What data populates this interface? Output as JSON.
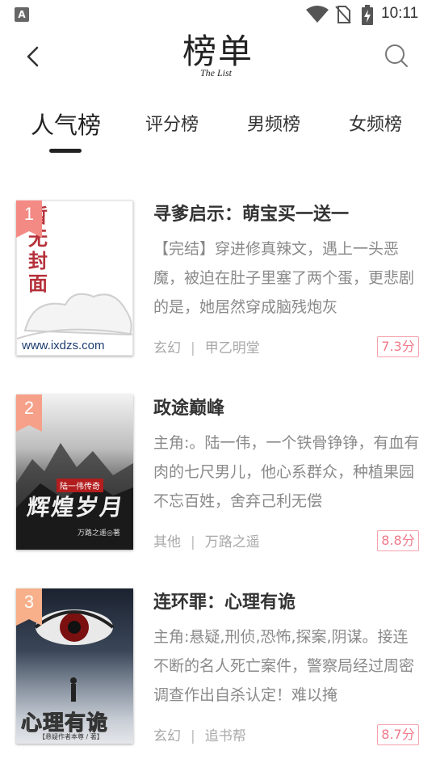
{
  "status_bar": {
    "app_icon_letter": "A",
    "time": "10:11",
    "icons": [
      "app-notification-icon",
      "wifi-icon",
      "no-sim-icon",
      "battery-charging-icon"
    ]
  },
  "header": {
    "title": "榜单",
    "subtitle": "The List",
    "back_icon": "chevron-left-icon",
    "search_icon": "search-icon"
  },
  "tabs": [
    {
      "label": "人气榜",
      "active": true
    },
    {
      "label": "评分榜",
      "active": false
    },
    {
      "label": "男频榜",
      "active": false
    },
    {
      "label": "女频榜",
      "active": false
    }
  ],
  "books": [
    {
      "rank": "1",
      "title": "寻爹启示：萌宝买一送一",
      "description": "【完结】穿进修真辣文，遇上一头恶魔，被迫在肚子里塞了两个蛋，更悲剧的是，她居然穿成脑残炮灰",
      "category": "玄幻",
      "author": "甲乙明堂",
      "score": "7.3分",
      "cover": {
        "text": "暂无封面",
        "url_text": "www.ixdzs.com",
        "badge_color": "#f48a84"
      }
    },
    {
      "rank": "2",
      "title": "政途巅峰",
      "description": "主角:。陆一伟，一个铁骨铮铮，有血有肉的七尺男儿，他心系群众，种植果园不忘百姓，舍弃己利无偿",
      "category": "其他",
      "author": "万路之遥",
      "score": "8.8分",
      "cover": {
        "tag_text": "陆一伟传奇",
        "title_text": "辉煌岁月",
        "author_text": "万路之遥◎著",
        "badge_color": "#f6a08a"
      }
    },
    {
      "rank": "3",
      "title": "连环罪：心理有诡",
      "description": "主角:悬疑,刑侦,恐怖,探案,阴谋。接连不断的名人死亡案件，警察局经过周密调查作出自杀认定！难以掩",
      "category": "玄幻",
      "author": "追书帮",
      "score": "8.7分",
      "cover": {
        "title_text": "心理有诡",
        "author_text": "【悬疑作者本尊 / 著】",
        "badge_color": "#f7b08a"
      }
    }
  ],
  "colors": {
    "score_border": "#f6a3ad",
    "score_text": "#f07a8a",
    "meta_text": "#a9a9a9",
    "desc_text": "#8a8a8a"
  }
}
